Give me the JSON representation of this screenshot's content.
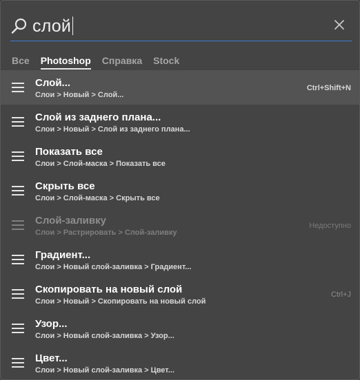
{
  "search": {
    "query": "слой",
    "search_icon": "search-icon",
    "close_icon": "close-icon"
  },
  "tabs": [
    {
      "label": "Все"
    },
    {
      "label": "Photoshop",
      "active": true
    },
    {
      "label": "Справка"
    },
    {
      "label": "Stock"
    }
  ],
  "results": [
    {
      "title": "Слой...",
      "path": "Слои > Новый > Слой...",
      "shortcut": "Ctrl+Shift+N",
      "selected": true
    },
    {
      "title": "Слой из заднего плана...",
      "path": "Слои > Новый > Слой из заднего плана...",
      "shortcut": ""
    },
    {
      "title": "Показать все",
      "path": "Слои > Слой-маска > Показать все",
      "shortcut": ""
    },
    {
      "title": "Скрыть все",
      "path": "Слои > Слой-маска > Скрыть все",
      "shortcut": ""
    },
    {
      "title": "Слой-заливку",
      "path": "Слои > Растрировать > Слой-заливку",
      "shortcut": "Недоступно",
      "disabled": true
    },
    {
      "title": "Градиент...",
      "path": "Слои > Новый слой-заливка > Градиент...",
      "shortcut": ""
    },
    {
      "title": "Скопировать на новый слой",
      "path": "Слои > Новый > Скопировать на новый слой",
      "shortcut": "Ctrl+J"
    },
    {
      "title": "Узор...",
      "path": "Слои > Новый слой-заливка > Узор...",
      "shortcut": ""
    },
    {
      "title": "Цвет...",
      "path": "Слои > Новый слой-заливка > Цвет...",
      "shortcut": ""
    }
  ],
  "colors": {
    "accent": "#3e7bd6",
    "panel_bg": "#444444",
    "selected_bg": "#535353"
  },
  "icons": {
    "result_icon": "menu-icon"
  }
}
